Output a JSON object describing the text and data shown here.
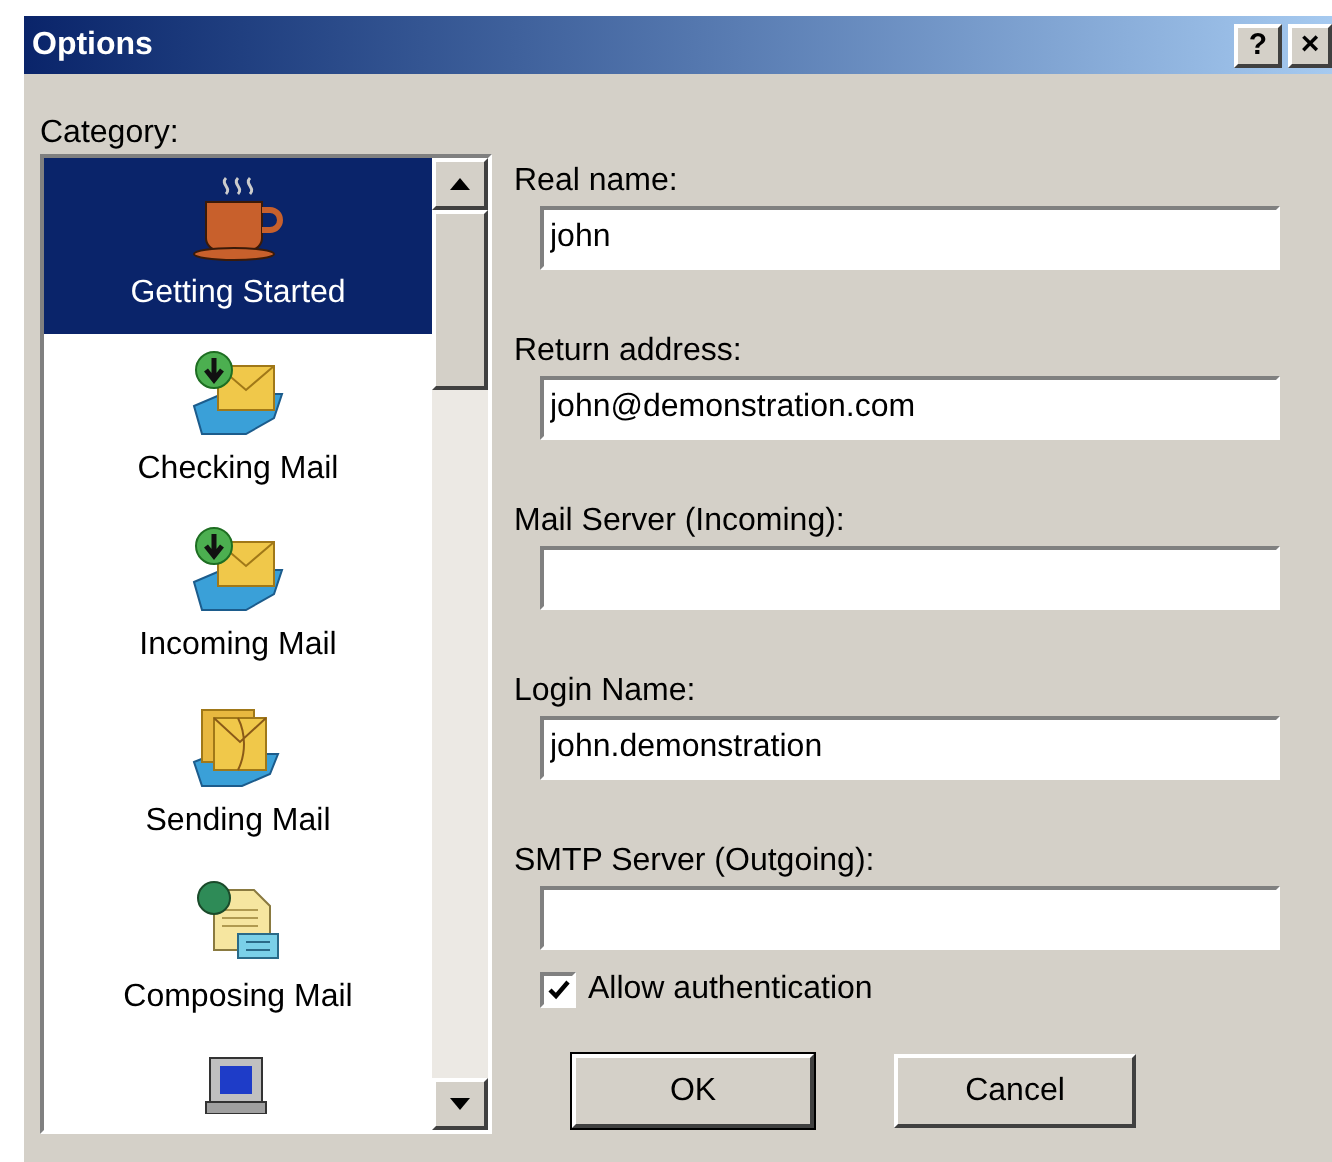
{
  "window": {
    "title": "Options",
    "help_button": "?",
    "close_button": "×"
  },
  "category": {
    "label": "Category:",
    "items": [
      {
        "label": "Getting Started",
        "kind": "cup",
        "selected": true
      },
      {
        "label": "Checking Mail",
        "kind": "download",
        "selected": false
      },
      {
        "label": "Incoming Mail",
        "kind": "download",
        "selected": false
      },
      {
        "label": "Sending Mail",
        "kind": "outbox",
        "selected": false
      },
      {
        "label": "Composing Mail",
        "kind": "compose",
        "selected": false
      },
      {
        "kind": "computer",
        "selected": false
      }
    ]
  },
  "fields": [
    {
      "label": "Real name:",
      "value": "john"
    },
    {
      "label": "Return address:",
      "value": "john@demonstration.com"
    },
    {
      "label": "Mail Server (Incoming):"
    },
    {
      "label": "Login Name:",
      "value": "john.demonstration"
    },
    {
      "label": "SMTP Server (Outgoing):"
    }
  ],
  "allow_authentication": {
    "label": "Allow authentication",
    "checked": true
  },
  "buttons": [
    {
      "label": "OK",
      "default": true
    },
    {
      "label": "Cancel",
      "default": false
    }
  ]
}
